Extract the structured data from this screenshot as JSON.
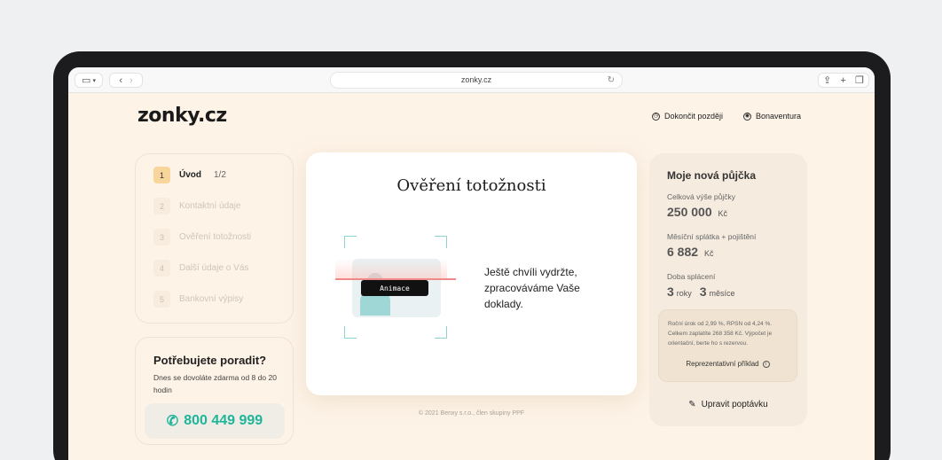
{
  "browser": {
    "url": "zonky.cz"
  },
  "header": {
    "logo": "zonky.cz",
    "finish_later": "Dokončit později",
    "user_name": "Bonaventura"
  },
  "steps": [
    {
      "num": "1",
      "label": "Úvod",
      "progress": "1/2",
      "state": "active"
    },
    {
      "num": "2",
      "label": "Kontaktní údaje",
      "state": "disabled"
    },
    {
      "num": "3",
      "label": "Ověření totožnosti",
      "state": "disabled"
    },
    {
      "num": "4",
      "label": "Další údaje o Vás",
      "state": "disabled"
    },
    {
      "num": "5",
      "label": "Bankovní výpisy",
      "state": "disabled"
    }
  ],
  "help": {
    "title": "Potřebujete poradit?",
    "subtitle": "Dnes se dovoláte zdarma od 8 do 20 hodin",
    "phone": "800 449 999"
  },
  "main": {
    "title": "Ověření totožnosti",
    "animation_label": "Animace",
    "message": "Ještě chvíli vydržte, zpracováváme Vaše doklady."
  },
  "footer": "© 2021 Benxy s.r.o., člen skupiny PPF",
  "loan": {
    "title": "Moje nová půjčka",
    "amount_label": "Celková výše půjčky",
    "amount_value": "250 000",
    "amount_unit": "Kč",
    "installment_label": "Měsíční splátka + pojištění",
    "installment_value": "6 882",
    "installment_unit": "Kč",
    "duration_label": "Doba splácení",
    "duration_years": "3",
    "duration_years_unit": "roky",
    "duration_months": "3",
    "duration_months_unit": "měsíce",
    "note": "Roční úrok od 2,99 %, RPSN od 4,24 %. Celkem zaplatíte 268 358 Kč. Výpočet je orientační, berte ho s rezervou.",
    "example_link": "Reprezentativní příklad",
    "edit_button": "Upravit poptávku"
  },
  "colors": {
    "accent": "#1fb59a",
    "step_active": "#f7d59b",
    "page_bg": "#fdf3e7"
  }
}
